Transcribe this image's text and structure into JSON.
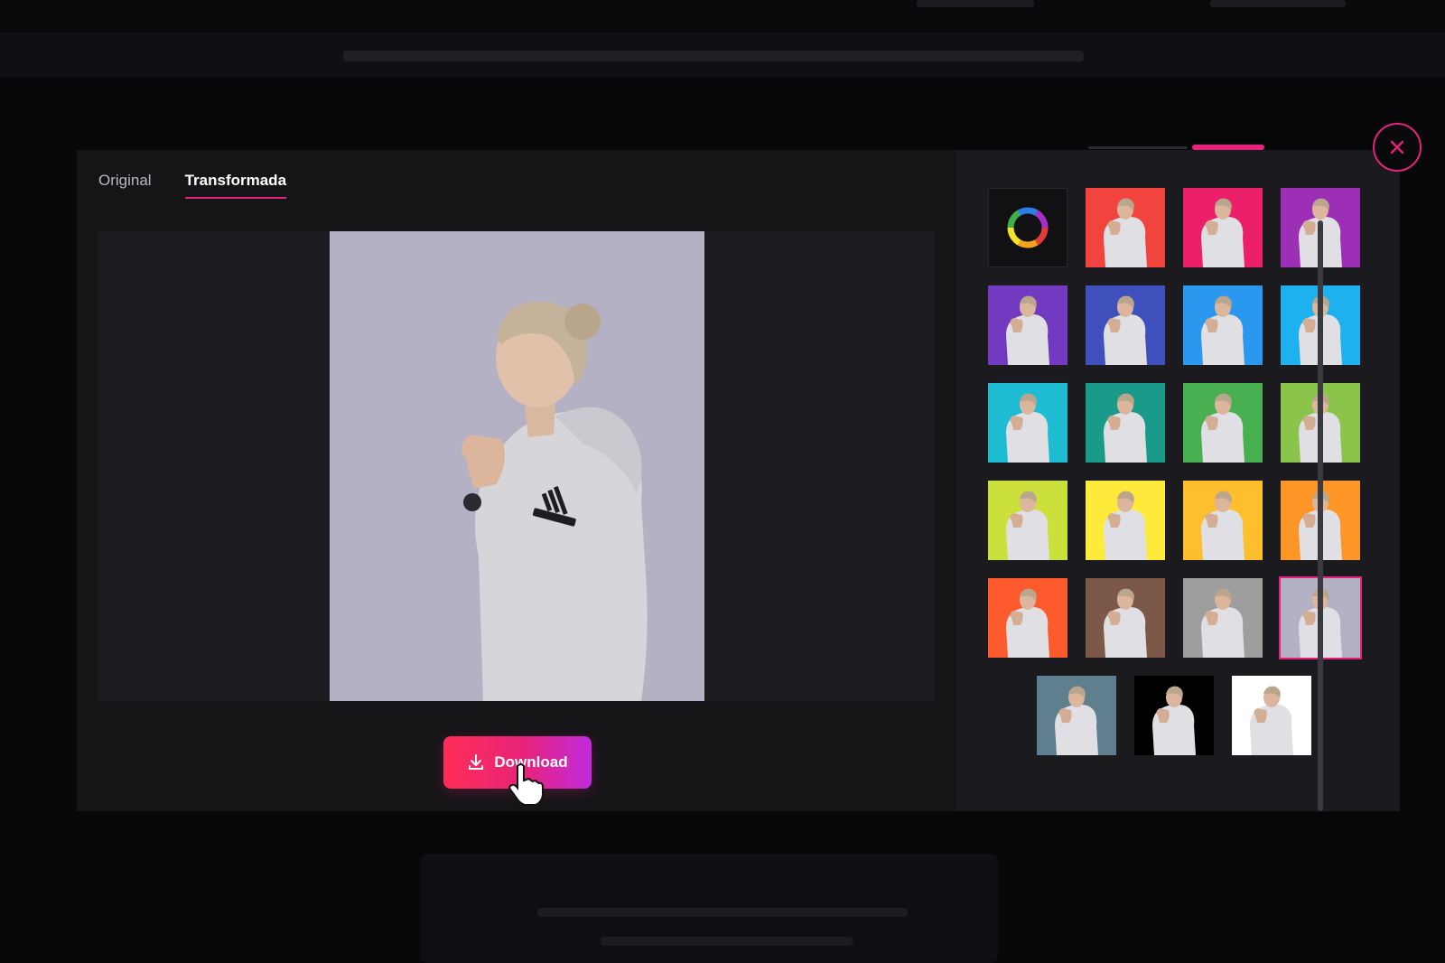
{
  "tabs": [
    {
      "label": "Original",
      "active": false
    },
    {
      "label": "Transformada",
      "active": true
    }
  ],
  "preview": {
    "background_color": "#b4b1c4",
    "subject": "woman in light grey hooded jacket"
  },
  "download_button": {
    "label": "Download",
    "icon": "download-icon"
  },
  "close_button": {
    "icon": "close-icon"
  },
  "color_picker": {
    "icon": "color-wheel-icon"
  },
  "swatches": [
    "#f1443e",
    "#ec1f6b",
    "#9c2fb5",
    "#7239c1",
    "#3f50bd",
    "#2a98ef",
    "#1db1ef",
    "#1ebcd2",
    "#1a9a88",
    "#49b052",
    "#8bc44a",
    "#cce03c",
    "#fdea3b",
    "#fdbf2e",
    "#fd9626",
    "#fd5a2d",
    "#7c5849",
    "#9e9e9e",
    "#b4b1c4",
    "#5f7e8e",
    "#000000",
    "#ffffff"
  ],
  "selected_swatch": "#b4b1c4",
  "accent": "#e6237a"
}
